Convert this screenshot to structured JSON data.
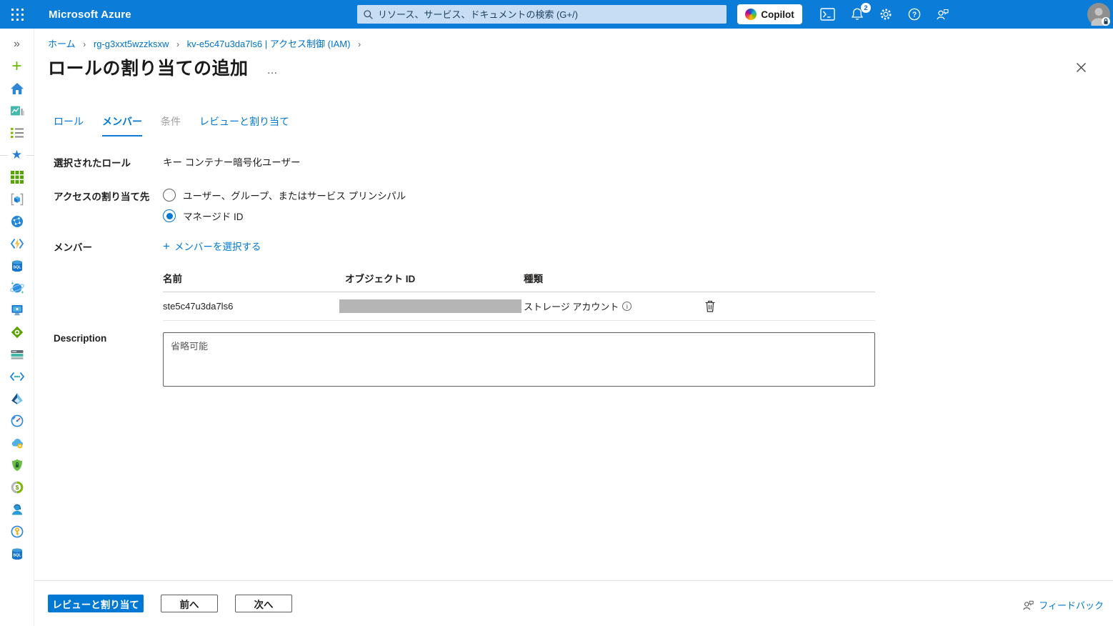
{
  "topbar": {
    "brand": "Microsoft Azure",
    "search_placeholder": "リソース、サービス、ドキュメントの検索 (G+/)",
    "copilot_label": "Copilot",
    "notification_count": "2"
  },
  "breadcrumb": {
    "home": "ホーム",
    "resource_group": "rg-g3xxt5wzzksxw",
    "resource": "kv-e5c47u3da7ls6 | アクセス制御 (IAM)",
    "separator": "›"
  },
  "page": {
    "title": "ロールの割り当ての追加",
    "more": "…"
  },
  "tabs": {
    "role": "ロール",
    "members": "メンバー",
    "conditions": "条件",
    "review_assign": "レビューと割り当て"
  },
  "form": {
    "selected_role_label": "選択されたロール",
    "selected_role_value": "キー コンテナー暗号化ユーザー",
    "assign_access_label": "アクセスの割り当て先",
    "option_user_group": "ユーザー、グループ、またはサービス プリンシパル",
    "option_managed_identity": "マネージド ID",
    "members_label": "メンバー",
    "select_members_plus": "+",
    "select_members_link": "メンバーを選択する",
    "table": {
      "headers": [
        "名前",
        "オブジェクト ID",
        "種類"
      ],
      "rows": [
        {
          "name": "ste5c47u3da7ls6",
          "object_id": "",
          "type": "ストレージ アカウント"
        }
      ]
    },
    "description_label": "Description",
    "description_placeholder": "省略可能"
  },
  "footer": {
    "review_assign": "レビューと割り当て",
    "previous": "前へ",
    "next": "次へ",
    "feedback": "フィードバック"
  },
  "sidebar": {
    "sql_label": "SQL",
    "icons": [
      "expand",
      "create-resource",
      "home",
      "dashboard",
      "all-services",
      "favorites",
      "all-resources",
      "resource-groups",
      "app-services",
      "function-app",
      "sql-databases",
      "cosmos-db",
      "virtual-machines",
      "load-balancers",
      "storage-accounts",
      "virtual-networks",
      "entra-id",
      "monitor",
      "advisor",
      "defender-for-cloud",
      "cost-management",
      "help-support",
      "key-vault",
      "sql-data-warehouse"
    ]
  },
  "colors": {
    "topbar_blue": "#0b7cd8",
    "accent_blue": "#0078d4",
    "link_blue": "#0072c9",
    "redacted_gray": "#b5b5b5"
  }
}
